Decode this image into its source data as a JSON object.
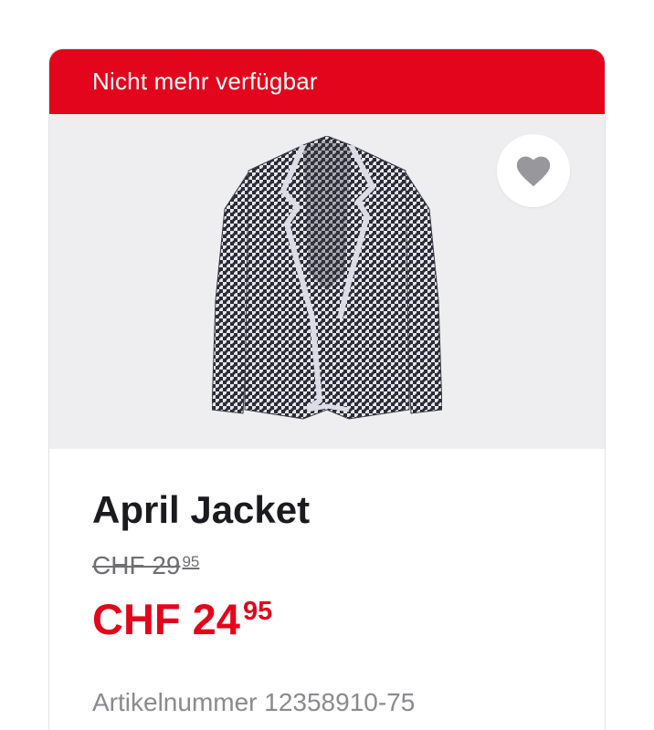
{
  "nav": {
    "back_icon": "chevron-left-icon"
  },
  "banner": {
    "text": "Nicht mehr verfügbar",
    "color": "#e3051b"
  },
  "favorite": {
    "icon": "heart-icon",
    "icon_color": "#98989c"
  },
  "product": {
    "image_icon": "houndstooth-jacket-image",
    "name": "April Jacket",
    "old_price_main": "CHF 29",
    "old_price_cents": "95",
    "new_price_main": "CHF 24",
    "new_price_cents": "95",
    "article_number": "Artikelnummer 12358910-75"
  },
  "colors": {
    "accent": "#e3051b",
    "text": "#1b1b1f",
    "muted": "#8a8a8f",
    "image_bg": "#eeeef0"
  }
}
